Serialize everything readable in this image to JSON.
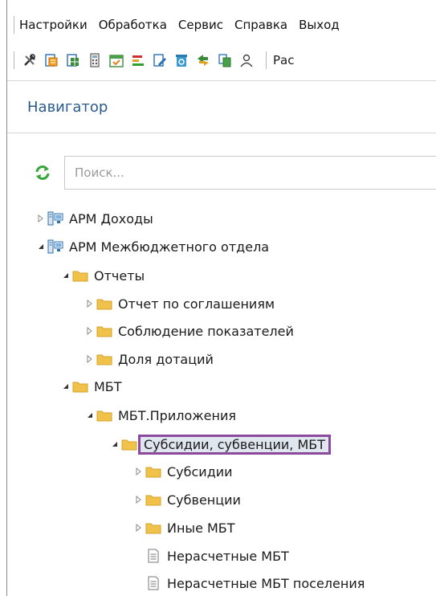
{
  "menu": [
    "Настройки",
    "Обработка",
    "Сервис",
    "Справка",
    "Выход"
  ],
  "toolbar": {
    "icons": [
      "tools-icon",
      "report-icon",
      "document-grid-icon",
      "calculator-icon",
      "calendar-icon",
      "chart-icon",
      "edit-document-icon",
      "recycle-icon",
      "transfer-icon",
      "copy-icon",
      "users-icon"
    ],
    "truncated_label": "Рас"
  },
  "navigator": {
    "title": "Навигатор",
    "search_placeholder": "Поиск..."
  },
  "tree": [
    {
      "label": "АРМ Доходы",
      "expanded": false,
      "icon": "workstation-icon"
    },
    {
      "label": "АРМ Межбюджетного отдела",
      "expanded": true,
      "icon": "workstation-icon"
    },
    {
      "label": "Отчеты",
      "expanded": true,
      "icon": "folder-icon"
    },
    {
      "label": "Отчет по соглашениям",
      "expanded": false,
      "icon": "folder-icon"
    },
    {
      "label": "Соблюдение показателей",
      "expanded": false,
      "icon": "folder-icon"
    },
    {
      "label": "Доля дотаций",
      "expanded": false,
      "icon": "folder-icon"
    },
    {
      "label": "МБТ",
      "expanded": true,
      "icon": "folder-icon"
    },
    {
      "label": "МБТ.Приложения",
      "expanded": true,
      "icon": "folder-icon"
    },
    {
      "label": "Субсидии, субвенции, МБТ",
      "expanded": true,
      "icon": "folder-icon",
      "selected": true
    },
    {
      "label": "Субсидии",
      "expanded": false,
      "icon": "folder-icon"
    },
    {
      "label": "Субвенции",
      "expanded": false,
      "icon": "folder-icon"
    },
    {
      "label": "Иные МБТ",
      "expanded": false,
      "icon": "folder-icon"
    },
    {
      "label": "Нерасчетные МБТ",
      "icon": "document-icon"
    },
    {
      "label": "Нерасчетные МБТ поселения",
      "icon": "document-icon"
    }
  ],
  "colors": {
    "accent": "#2a5a8c",
    "selection_border": "#8b4a9c",
    "folder": "#f0c24a",
    "refresh": "#3aa53a"
  }
}
